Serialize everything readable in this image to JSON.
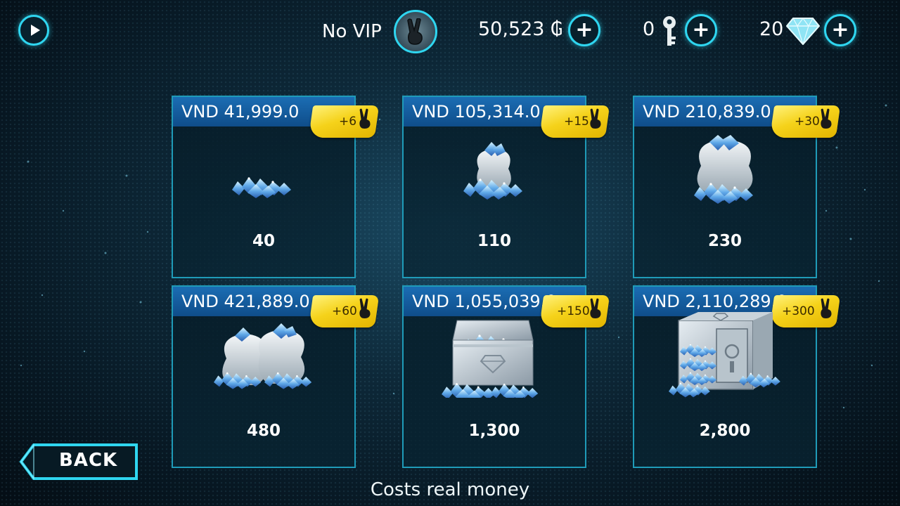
{
  "topbar": {
    "vip_label": "No VIP",
    "coins": "50,523 ₲",
    "keys": "0",
    "gems": "20"
  },
  "offers": [
    {
      "price": "VND 41,999.0",
      "bonus": "+6",
      "amount": "40",
      "art": "small-pile"
    },
    {
      "price": "VND 105,314.0",
      "bonus": "+15",
      "amount": "110",
      "art": "small-bag"
    },
    {
      "price": "VND 210,839.0",
      "bonus": "+30",
      "amount": "230",
      "art": "big-bag"
    },
    {
      "price": "VND 421,889.0",
      "bonus": "+60",
      "amount": "480",
      "art": "two-bags"
    },
    {
      "price": "VND 1,055,039.0",
      "bonus": "+150",
      "amount": "1,300",
      "art": "case"
    },
    {
      "price": "VND 2,110,289.0",
      "bonus": "+300",
      "amount": "2,800",
      "art": "safe"
    }
  ],
  "back_label": "BACK",
  "footer_note": "Costs real money",
  "colors": {
    "accent": "#2fd6f0",
    "price_band": "#1b6db4",
    "bonus_tag": "#f5d21a",
    "card_border": "#1f9bb8"
  },
  "icons": [
    "play-icon",
    "vip-peace-badge-icon",
    "coin-icon",
    "key-icon",
    "gem-icon",
    "plus-icon",
    "peace-hand-icon",
    "back-arrow-icon"
  ]
}
